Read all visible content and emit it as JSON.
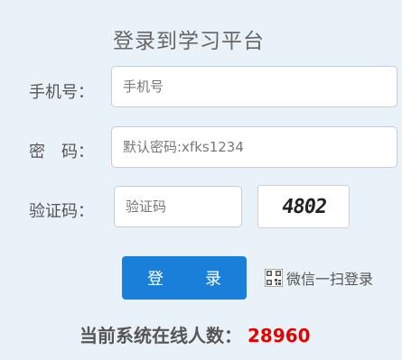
{
  "title": "登录到学习平台",
  "form": {
    "phone": {
      "label": "手机号：",
      "placeholder": "手机号"
    },
    "password": {
      "label": "密　码：",
      "placeholder": "默认密码:xfks1234"
    },
    "captcha": {
      "label": "验证码：",
      "placeholder": "验证码",
      "image_text": "4802"
    }
  },
  "login_button": "登　录",
  "wechat_login": {
    "icon": "qr-code-icon",
    "label": "微信一扫登录"
  },
  "online": {
    "label": "当前系统在线人数：",
    "count": "28960"
  },
  "colors": {
    "background": "#e9f2f8",
    "button": "#1a7fd8",
    "count": "#e60000"
  }
}
